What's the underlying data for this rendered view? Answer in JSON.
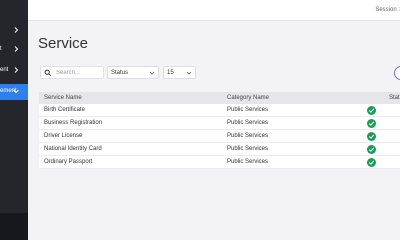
{
  "colors": {
    "accent": "#2f80ed",
    "sidebar": "#24262b",
    "success": "#1a9e57"
  },
  "topbar": {
    "session_text": "Session :"
  },
  "sidebar": {
    "items": [
      {
        "label": "",
        "icon": "chevron-right-icon"
      },
      {
        "label": "t",
        "icon": "chevron-right-icon"
      },
      {
        "label": "ent",
        "icon": "chevron-right-icon"
      },
      {
        "label": "ement",
        "icon": "chevron-down-icon",
        "active": true
      }
    ]
  },
  "page": {
    "title": "Service"
  },
  "filters": {
    "search_placeholder": "Search...",
    "status_value": "Status",
    "page_size_value": "15"
  },
  "table": {
    "headers": [
      "Service Name",
      "Category Name",
      "Stat"
    ],
    "rows": [
      {
        "service": "Birth Certificate",
        "category": "Public Services",
        "status": "active"
      },
      {
        "service": "Business Registration",
        "category": "Public Services",
        "status": "active"
      },
      {
        "service": "Driver License",
        "category": "Public Services",
        "status": "active"
      },
      {
        "service": "National Identity Card",
        "category": "Public Services",
        "status": "active"
      },
      {
        "service": "Ordinary Passport",
        "category": "Public Services",
        "status": "active"
      }
    ]
  }
}
